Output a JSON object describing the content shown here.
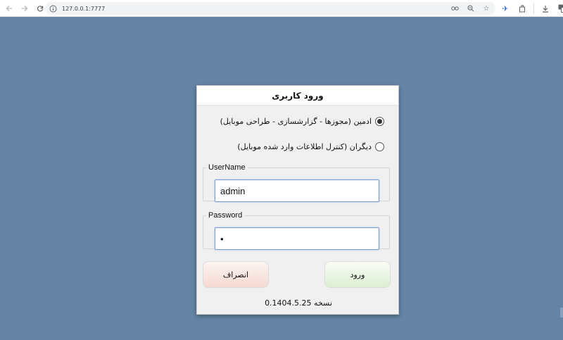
{
  "browser": {
    "url": "127.0.0.1:7777"
  },
  "dialog": {
    "title": "ورود کاربری",
    "radio_options": [
      {
        "label": "ادمین (مجوزها - گزارشسازی - طراحی موبایل)",
        "selected": true
      },
      {
        "label": "دیگران (کنترل اطلاعات وارد شده موبایل)",
        "selected": false
      }
    ],
    "username": {
      "legend": "UserName",
      "value": "admin"
    },
    "password": {
      "legend": "Password",
      "value": "•"
    },
    "login_button": "ورود",
    "cancel_button": "انصراف",
    "version_text": "نسخه 0.1404.5.25"
  },
  "colors": {
    "background": "#6584a6",
    "login_button": "#dcefd3",
    "cancel_button": "#f6d9d2"
  }
}
